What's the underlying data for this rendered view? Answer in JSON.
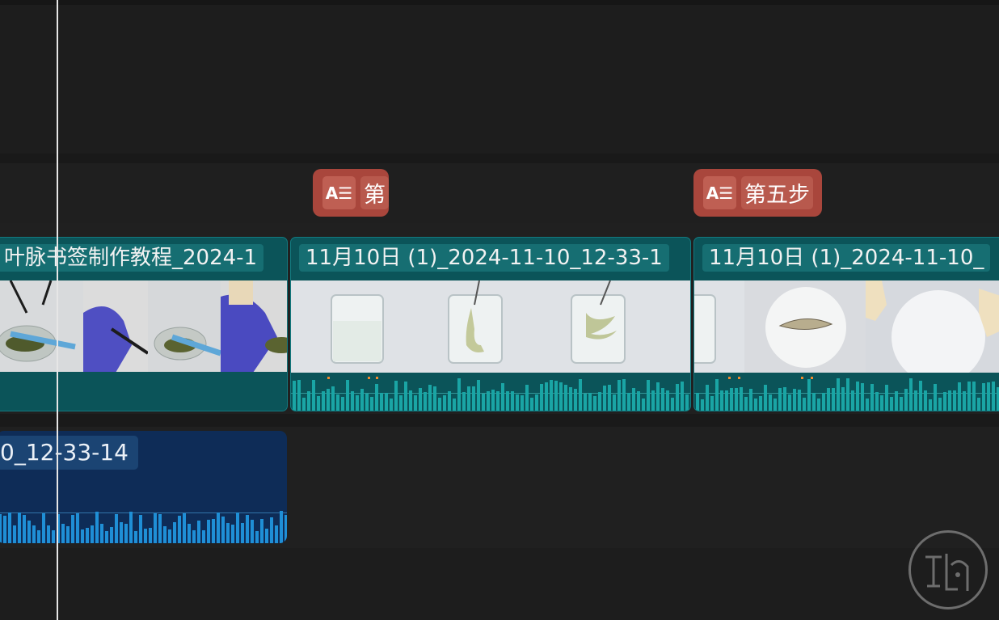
{
  "timeline": {
    "text_clips": [
      {
        "label": "第",
        "icon": "text-caption-icon"
      },
      {
        "label": "第五步",
        "icon": "text-caption-icon"
      }
    ],
    "video_clips": [
      {
        "title": "叶脉书签制作教程_2024-1"
      },
      {
        "title": "11月10日 (1)_2024-11-10_12-33-1"
      },
      {
        "title": "11月10日 (1)_2024-11-10_"
      }
    ],
    "audio_clip": {
      "title": "0_12-33-14"
    },
    "colors": {
      "background": "#1d1d1d",
      "text_clip": "#a9463c",
      "video_clip": "#0b5459",
      "video_waveform": "#1aa5a5",
      "audio_clip": "#0e2c57",
      "audio_waveform": "#1f8fd6",
      "playhead": "#e6e6e6"
    }
  }
}
